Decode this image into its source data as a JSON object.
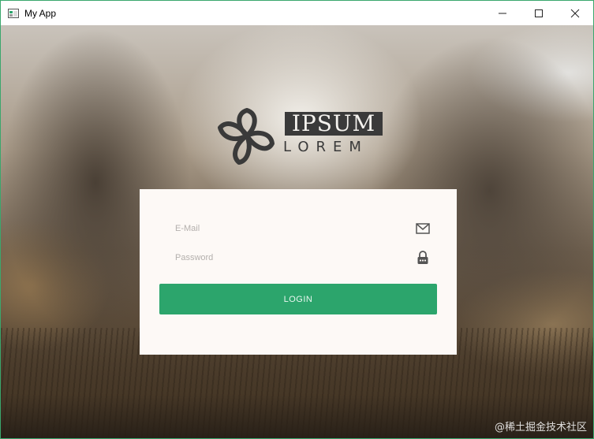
{
  "window": {
    "title": "My App",
    "controls": [
      "minimize-icon",
      "maximize-icon",
      "close-icon"
    ]
  },
  "logo": {
    "top_word": "IPSUM",
    "bottom_word": "LOREM",
    "mark_icon": "flower-icon"
  },
  "login_form": {
    "email_placeholder": "E-Mail",
    "email_value": "",
    "email_icon": "envelope-icon",
    "password_placeholder": "Password",
    "password_value": "",
    "password_icon": "lock-icon",
    "login_label": "LOGIN"
  },
  "watermark": "@稀土掘金技术社区",
  "colors": {
    "accent": "#2ca56c",
    "card": "#fdf9f6",
    "logo": "#3a3a3a",
    "window_border": "#3aa76d"
  }
}
